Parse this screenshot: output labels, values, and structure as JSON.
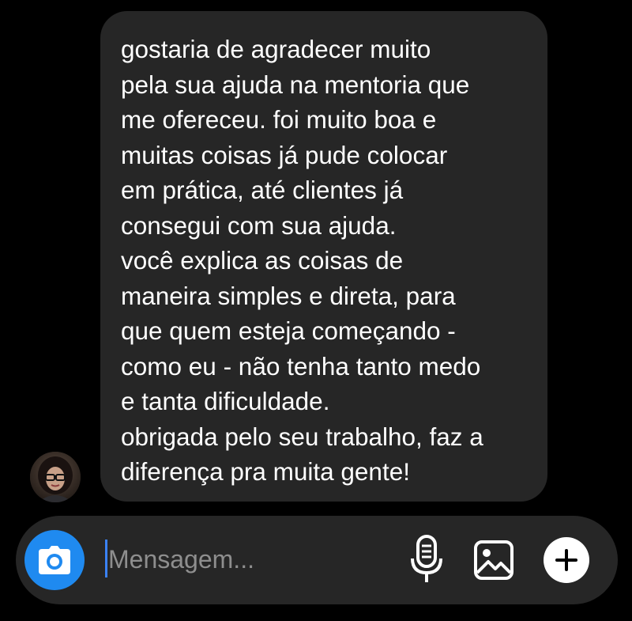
{
  "conversation": {
    "message": {
      "lines": [
        "gostaria de agradecer muito",
        "pela sua ajuda na mentoria que",
        "me ofereceu. foi muito boa e",
        "muitas coisas já pude colocar",
        "em prática, até clientes já",
        "consegui com sua ajuda.",
        "você explica as coisas de",
        "maneira simples e direta, para",
        "que quem esteja começando -",
        "como eu - não tenha tanto medo",
        "e tanta dificuldade.",
        "obrigada pelo seu trabalho, faz a",
        "diferença pra muita gente!"
      ]
    }
  },
  "composer": {
    "placeholder": "Mensagem...",
    "value": "",
    "icons": {
      "camera": "camera-icon",
      "mic": "microphone-icon",
      "gallery": "gallery-icon",
      "add": "plus-icon"
    }
  },
  "colors": {
    "background": "#000000",
    "bubble": "#262626",
    "composer": "#262626",
    "accent": "#1f8af0",
    "placeholder": "#8e8e8e",
    "text": "#ffffff"
  }
}
